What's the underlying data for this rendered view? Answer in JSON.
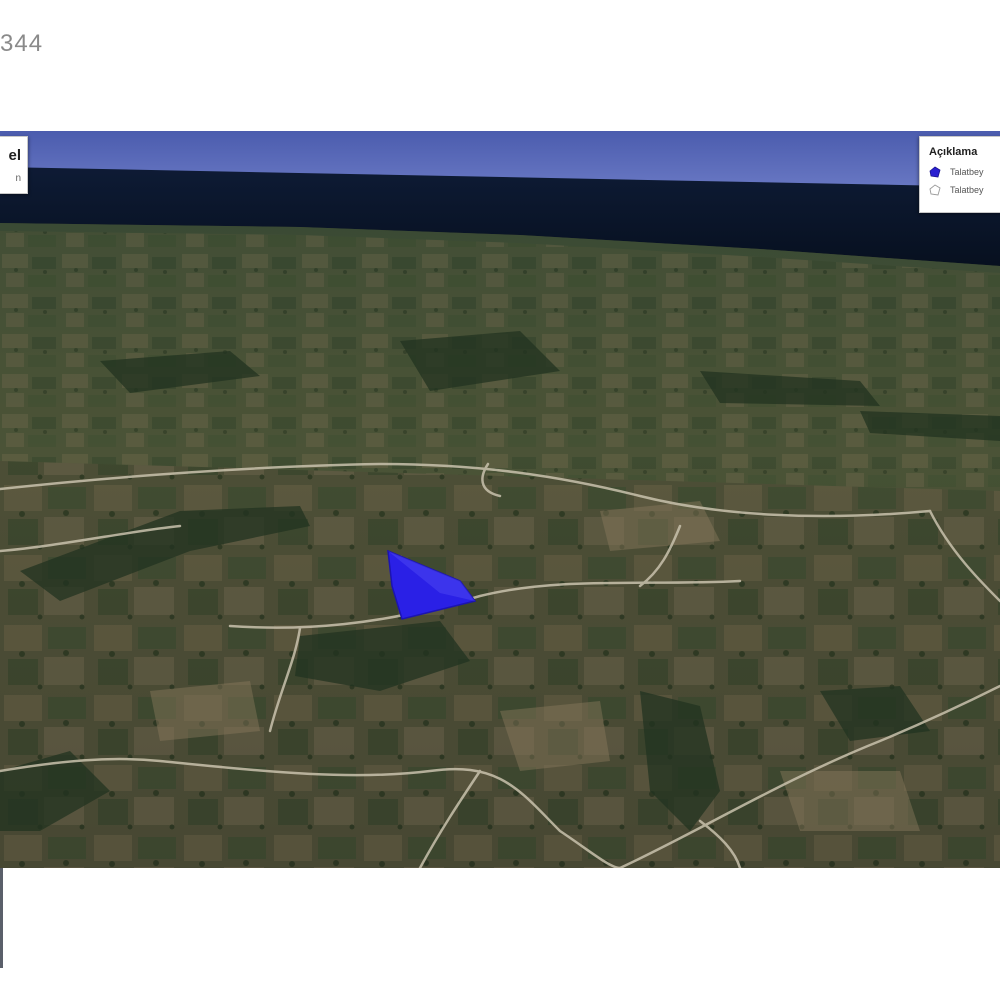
{
  "header": {
    "number_text": "344"
  },
  "title_card": {
    "title": "el",
    "subtitle": "n"
  },
  "legend": {
    "title": "Açıklama",
    "items": [
      {
        "label": "Talatbey",
        "swatch": "filled-polygon-icon",
        "color": "#2a1fd0"
      },
      {
        "label": "Talatbey",
        "swatch": "outline-polygon-icon",
        "color": "#ffffff"
      }
    ]
  },
  "map": {
    "type": "3D satellite view",
    "parcel_color": "#2a20e6",
    "sea_color": "#0b1830",
    "sky_color": "#5666b8"
  }
}
